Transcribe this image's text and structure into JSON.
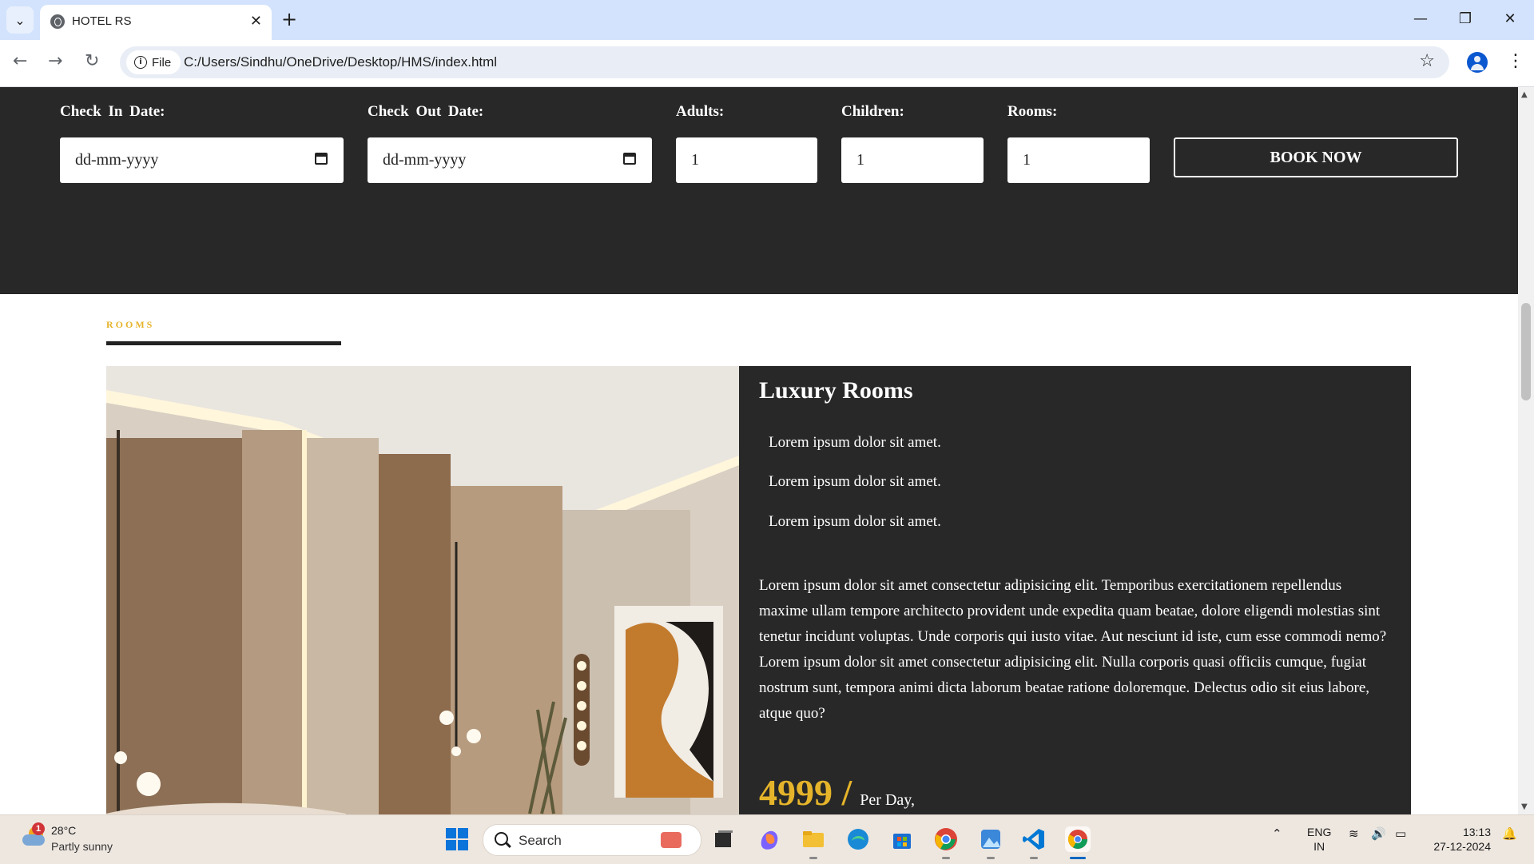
{
  "browser": {
    "tab_title": "HOTEL RS",
    "tab_close": "✕",
    "new_tab": "+",
    "tab_menu": "⌄",
    "chip_label": "File",
    "url": "C:/Users/Sindhu/OneDrive/Desktop/HMS/index.html",
    "window_controls": [
      "—",
      "❐",
      "✕"
    ]
  },
  "booking": {
    "check_in_label": "Check In Date:",
    "check_in_placeholder": "dd-mm-yyyy",
    "check_out_label": "Check Out Date:",
    "check_out_placeholder": "dd-mm-yyyy",
    "adults_label": "Adults:",
    "adults_value": "1",
    "children_label": "Children:",
    "children_value": "1",
    "rooms_label": "Rooms:",
    "rooms_value": "1",
    "book_button": "BOOK NOW"
  },
  "rooms_section": {
    "label": "ROOMS",
    "room": {
      "title": "Luxury Rooms",
      "features": [
        "Lorem ipsum dolor sit amet.",
        "Lorem ipsum dolor sit amet.",
        "Lorem ipsum dolor sit amet."
      ],
      "paragraph_1": "Lorem ipsum dolor sit amet consectetur adipisicing elit. Temporibus exercitationem repellendus maxime ullam tempore architecto provident unde expedita quam beatae, dolore eligendi molestias sint tenetur incidunt voluptas. Unde corporis qui iusto vitae. Aut nesciunt id iste, cum esse commodi nemo?",
      "paragraph_2": "Lorem ipsum dolor sit amet consectetur adipisicing elit. Nulla corporis quasi officiis cumque, fugiat nostrum sunt, tempora animi dicta laborum beatae ratione doloremque. Delectus odio sit eius labore, atque quo?",
      "price": "4999 /",
      "price_unit": "Per Day,"
    }
  },
  "taskbar": {
    "weather_temp": "28°C",
    "weather_condition": "Partly sunny",
    "weather_badge": "1",
    "search_placeholder": "Search",
    "lang_line1": "ENG",
    "lang_line2": "IN",
    "time": "13:13",
    "date": "27-12-2024",
    "colors": {
      "accent_gold": "#e5b42a",
      "dark_panel": "#282828"
    }
  }
}
